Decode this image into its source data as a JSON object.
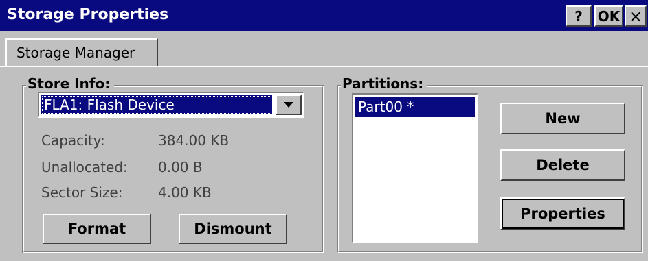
{
  "window": {
    "title": "Storage Properties"
  },
  "titlebar_buttons": {
    "help": "?",
    "ok": "OK",
    "close": "×"
  },
  "tabs": [
    {
      "label": "Storage Manager"
    }
  ],
  "store_info": {
    "label": "Store Info:",
    "selected_store": "FLA1: Flash Device",
    "rows": [
      {
        "label": "Capacity:",
        "value": "384.00 KB"
      },
      {
        "label": "Unallocated:",
        "value": "0.00 B"
      },
      {
        "label": "Sector Size:",
        "value": "4.00 KB"
      }
    ],
    "buttons": {
      "format": "Format",
      "dismount": "Dismount"
    }
  },
  "partitions": {
    "label": "Partitions:",
    "items": [
      {
        "label": "Part00 *",
        "selected": true
      }
    ],
    "buttons": {
      "new": "New",
      "delete": "Delete",
      "properties": "Properties"
    }
  },
  "colors": {
    "titlebar": "#0a0a80",
    "face": "#c0c0c0",
    "selection": "#0a0a80"
  }
}
